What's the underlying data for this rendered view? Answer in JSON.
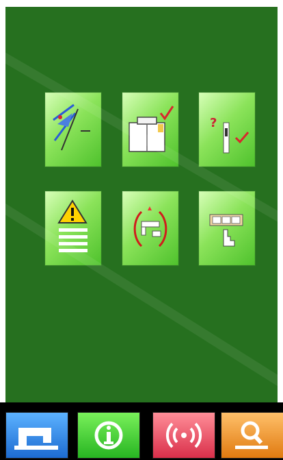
{
  "colors": {
    "panel": "#26701f",
    "tile_light": "#d7ffb8",
    "tile_dark": "#4fc22d",
    "nav_blue": "#1d6bd1",
    "nav_green": "#27b522",
    "nav_red": "#d92f4a",
    "nav_orange": "#e07a10"
  },
  "menu_tiles": [
    {
      "icon": "thread-trimming-icon"
    },
    {
      "icon": "shirt-pattern-check-icon"
    },
    {
      "icon": "needle-help-icon"
    },
    {
      "icon": "warning-list-icon"
    },
    {
      "icon": "machine-cycle-icon"
    },
    {
      "icon": "keypad-hand-icon"
    }
  ],
  "nav_bar": [
    {
      "icon": "sewing-machine-icon",
      "color": "#1d6bd1"
    },
    {
      "icon": "info-icon",
      "color": "#27b522"
    },
    {
      "icon": "wireless-communication-icon",
      "color": "#d92f4a"
    },
    {
      "icon": "magnifier-search-icon",
      "color": "#e07a10"
    }
  ]
}
